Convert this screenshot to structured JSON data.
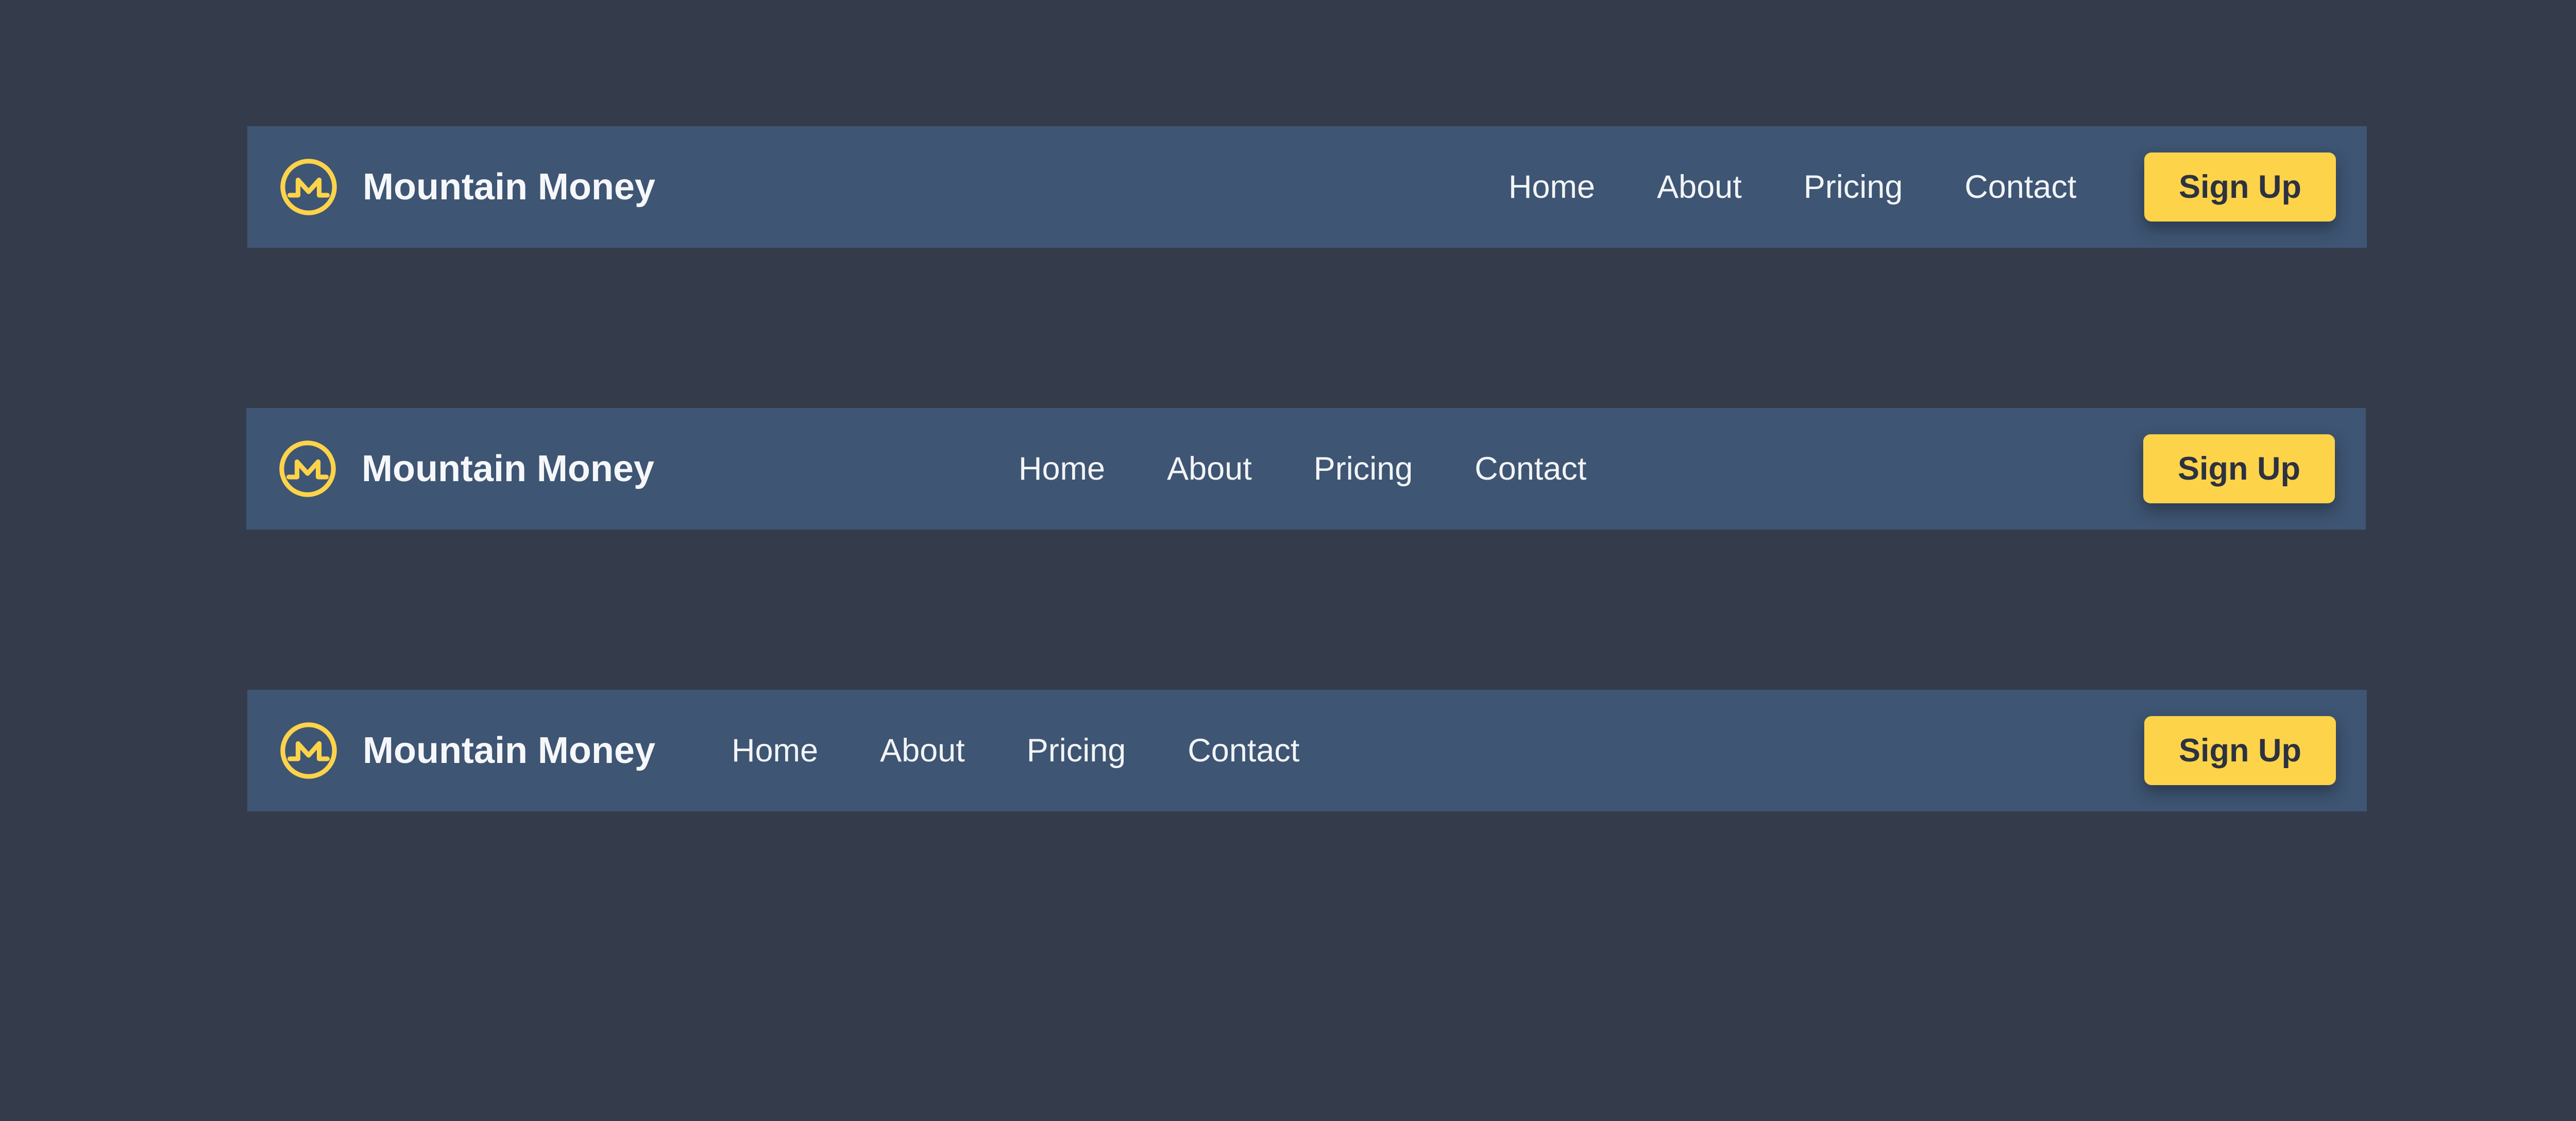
{
  "colors": {
    "page_background": "#343c4b",
    "navbar_background": "#3e5573",
    "accent": "#fdd34a",
    "text_light": "#f6f7fa",
    "button_text": "#2d3240"
  },
  "navbars": [
    {
      "variant": "links-right",
      "logo_icon": "mountain-coin-logo-icon",
      "brand": "Mountain Money",
      "links": [
        "Home",
        "About",
        "Pricing",
        "Contact"
      ],
      "cta": "Sign Up"
    },
    {
      "variant": "links-center",
      "logo_icon": "mountain-coin-logo-icon",
      "brand": "Mountain Money",
      "links": [
        "Home",
        "About",
        "Pricing",
        "Contact"
      ],
      "cta": "Sign Up"
    },
    {
      "variant": "links-left",
      "logo_icon": "mountain-coin-logo-icon",
      "brand": "Mountain Money",
      "links": [
        "Home",
        "About",
        "Pricing",
        "Contact"
      ],
      "cta": "Sign Up"
    }
  ]
}
